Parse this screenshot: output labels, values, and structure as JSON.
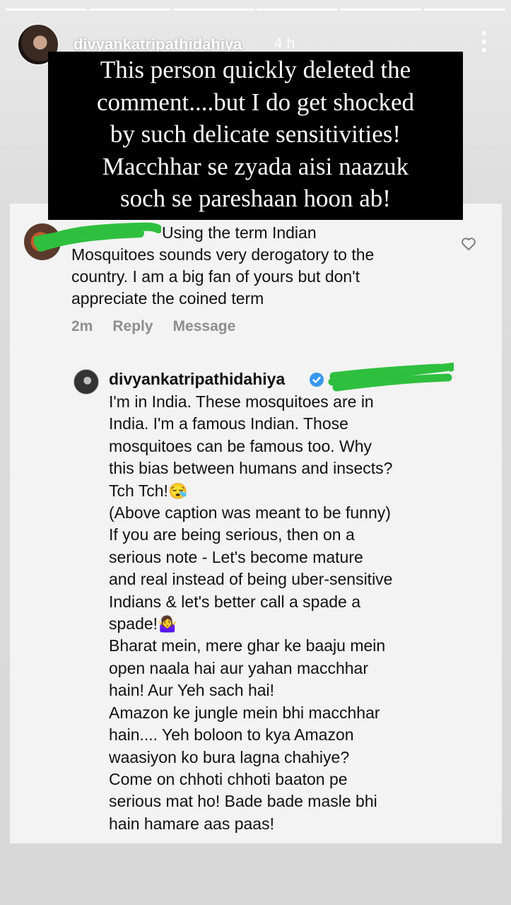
{
  "story": {
    "progress_segments": 6,
    "username": "divyankatripathidahiya",
    "time": "4 h",
    "caption_lines": [
      "This person quickly deleted the",
      "comment....but I do get shocked",
      "by such delicate sensitivities!",
      "Macchhar se zyada aisi naazuk",
      "soch se pareshaan hoon ab!"
    ]
  },
  "comment": {
    "lines": [
      "Using the term Indian",
      "Mosquitoes sounds very derogatory to the",
      "country. I am a big fan of yours but don't",
      "appreciate the coined term"
    ],
    "time": "2m",
    "reply_label": "Reply",
    "message_label": "Message",
    "accent_scribble_color": "#2fbf3f"
  },
  "reply": {
    "username": "divyankatripathidahiya",
    "lines": [
      "I'm in India. These mosquitoes are in",
      "India. I'm a famous Indian. Those",
      "mosquitoes can be famous too. Why",
      "this bias between humans and insects?",
      "Tch Tch!",
      "(Above caption was meant to be funny)",
      "If you are being serious, then on a",
      "serious note - Let's become mature",
      "and real instead of being uber-sensitive",
      "Indians & let's better call a spade a",
      "spade!",
      "Bharat mein, mere ghar ke baaju mein",
      "open naala hai aur yahan macchhar",
      "hain! Aur Yeh sach hai!",
      "Amazon ke jungle mein bhi macchhar",
      "hain.... Yeh boloon to kya Amazon",
      "waasiyon ko bura lagna chahiye?",
      "Come on chhoti chhoti baaton pe",
      "serious mat ho! Bade bade masle bhi",
      "hain hamare aas paas!"
    ],
    "emoji_sad": "😪",
    "emoji_shrug": "🤷‍♀️",
    "verified_color": "#3897f0"
  }
}
